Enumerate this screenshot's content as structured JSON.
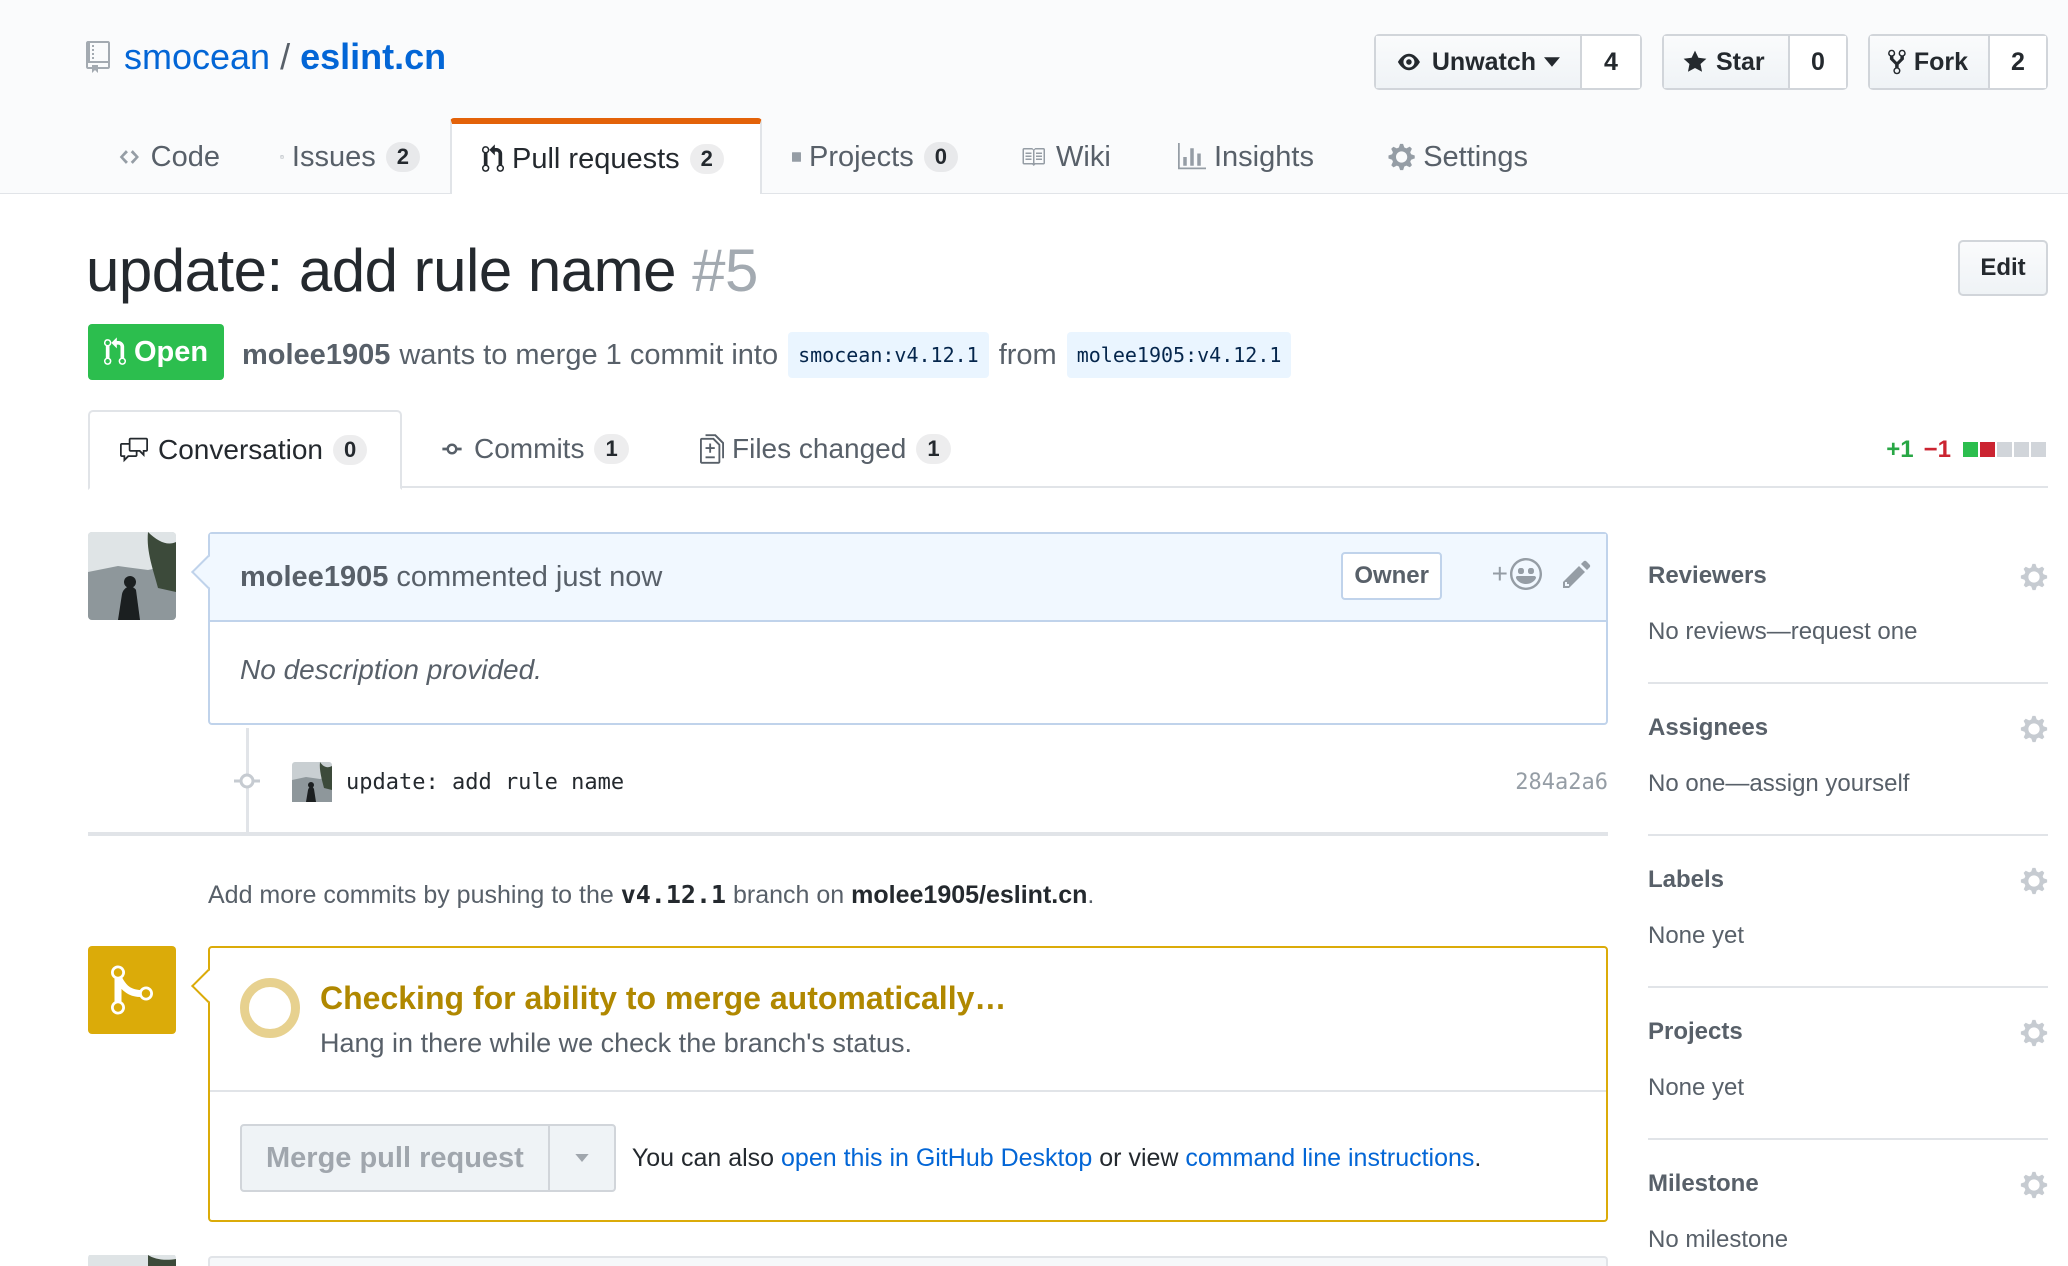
{
  "repo": {
    "owner": "smocean",
    "separator": "/",
    "name": "eslint.cn"
  },
  "actions": {
    "watch": {
      "label": "Unwatch",
      "count": "4"
    },
    "star": {
      "label": "Star",
      "count": "0"
    },
    "fork": {
      "label": "Fork",
      "count": "2"
    }
  },
  "reponav": [
    {
      "label": "Code",
      "icon": "code-icon"
    },
    {
      "label": "Issues",
      "count": "2",
      "icon": "issue-opened-icon"
    },
    {
      "label": "Pull requests",
      "count": "2",
      "icon": "git-pull-request-icon",
      "selected": true
    },
    {
      "label": "Projects",
      "count": "0",
      "icon": "project-icon"
    },
    {
      "label": "Wiki",
      "icon": "book-icon"
    },
    {
      "label": "Insights",
      "icon": "graph-icon"
    },
    {
      "label": "Settings",
      "icon": "gear-icon"
    }
  ],
  "pr": {
    "title": "update: add rule name",
    "number": "#5",
    "edit_label": "Edit",
    "state": "Open",
    "author": "molee1905",
    "merge_text": "wants to merge 1 commit into",
    "base_branch": "smocean:v4.12.1",
    "from_text": "from",
    "head_branch": "molee1905:v4.12.1"
  },
  "pr_tabs": {
    "conversation": {
      "label": "Conversation",
      "count": "0"
    },
    "commits": {
      "label": "Commits",
      "count": "1"
    },
    "files": {
      "label": "Files changed",
      "count": "1"
    }
  },
  "diffstat": {
    "additions": "+1",
    "deletions": "−1",
    "blocks": [
      "#2cbe4e",
      "#cb2431",
      "#d1d5da",
      "#d1d5da",
      "#d1d5da"
    ]
  },
  "comment": {
    "author": "molee1905",
    "action": "commented just now",
    "badge": "Owner",
    "body": "No description provided.",
    "reaction_plus": "+"
  },
  "commit": {
    "message": "update: add rule name",
    "sha": "284a2a6"
  },
  "push_hint": {
    "prefix": "Add more commits by pushing to the",
    "branch": "v4.12.1",
    "middle": "branch on",
    "repo": "molee1905/eslint.cn",
    "suffix": "."
  },
  "merge": {
    "heading": "Checking for ability to merge automatically…",
    "sub": "Hang in there while we check the branch's status.",
    "button": "Merge pull request",
    "alt_prefix": "You can also",
    "alt_link1": "open this in GitHub Desktop",
    "alt_middle": "or view",
    "alt_link2": "command line instructions",
    "alt_suffix": "."
  },
  "sidebar": [
    {
      "title": "Reviewers",
      "value": "No reviews—request one"
    },
    {
      "title": "Assignees",
      "value": "No one—assign yourself"
    },
    {
      "title": "Labels",
      "value": "None yet"
    },
    {
      "title": "Projects",
      "value": "None yet"
    },
    {
      "title": "Milestone",
      "value": "No milestone"
    }
  ],
  "colors": {
    "link": "#0366d6",
    "open": "#2cbe4e",
    "pending": "#dbab09",
    "tab_accent": "#e36209"
  }
}
